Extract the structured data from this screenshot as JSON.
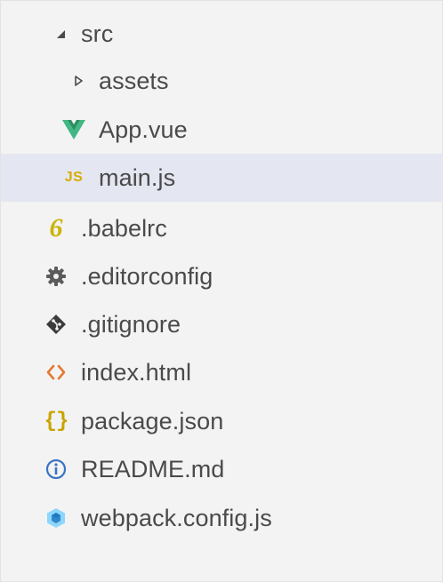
{
  "explorer": {
    "items": [
      {
        "label": "src",
        "icon": "expanded-chevron-icon",
        "kind": "folder",
        "expanded": true,
        "depth": 0,
        "selected": false
      },
      {
        "label": "assets",
        "icon": "collapsed-chevron-icon",
        "kind": "folder",
        "expanded": false,
        "depth": 1,
        "selected": false
      },
      {
        "label": "App.vue",
        "icon": "vue-icon",
        "kind": "file",
        "depth": 1,
        "selected": false
      },
      {
        "label": "main.js",
        "icon": "js-icon",
        "icon_text": "JS",
        "kind": "file",
        "depth": 1,
        "selected": true
      },
      {
        "label": ".babelrc",
        "icon": "babel-icon",
        "icon_text": "6",
        "kind": "file",
        "depth": 0,
        "selected": false
      },
      {
        "label": ".editorconfig",
        "icon": "gear-icon",
        "kind": "file",
        "depth": 0,
        "selected": false
      },
      {
        "label": ".gitignore",
        "icon": "git-icon",
        "kind": "file",
        "depth": 0,
        "selected": false
      },
      {
        "label": "index.html",
        "icon": "html-icon",
        "kind": "file",
        "depth": 0,
        "selected": false
      },
      {
        "label": "package.json",
        "icon": "json-icon",
        "icon_text": "{}",
        "kind": "file",
        "depth": 0,
        "selected": false
      },
      {
        "label": "README.md",
        "icon": "info-icon",
        "kind": "file",
        "depth": 0,
        "selected": false
      },
      {
        "label": "webpack.config.js",
        "icon": "webpack-icon",
        "kind": "file",
        "depth": 0,
        "selected": false
      }
    ]
  },
  "colors": {
    "panel_background": "#f3f3f3",
    "selected_row": "#e4e6f1",
    "text": "#4a4a4a",
    "vue_green": "#41b883",
    "vue_dark": "#2c8f61",
    "js_yellow": "#d6ad00",
    "babel_yellow": "#c9b300",
    "gear_gray": "#5b5b5b",
    "git_dark": "#3c3c3c",
    "html_orange": "#e37933",
    "json_yellow": "#c9a400",
    "info_blue": "#3b73c4",
    "webpack_blue": "#2e88c9"
  }
}
